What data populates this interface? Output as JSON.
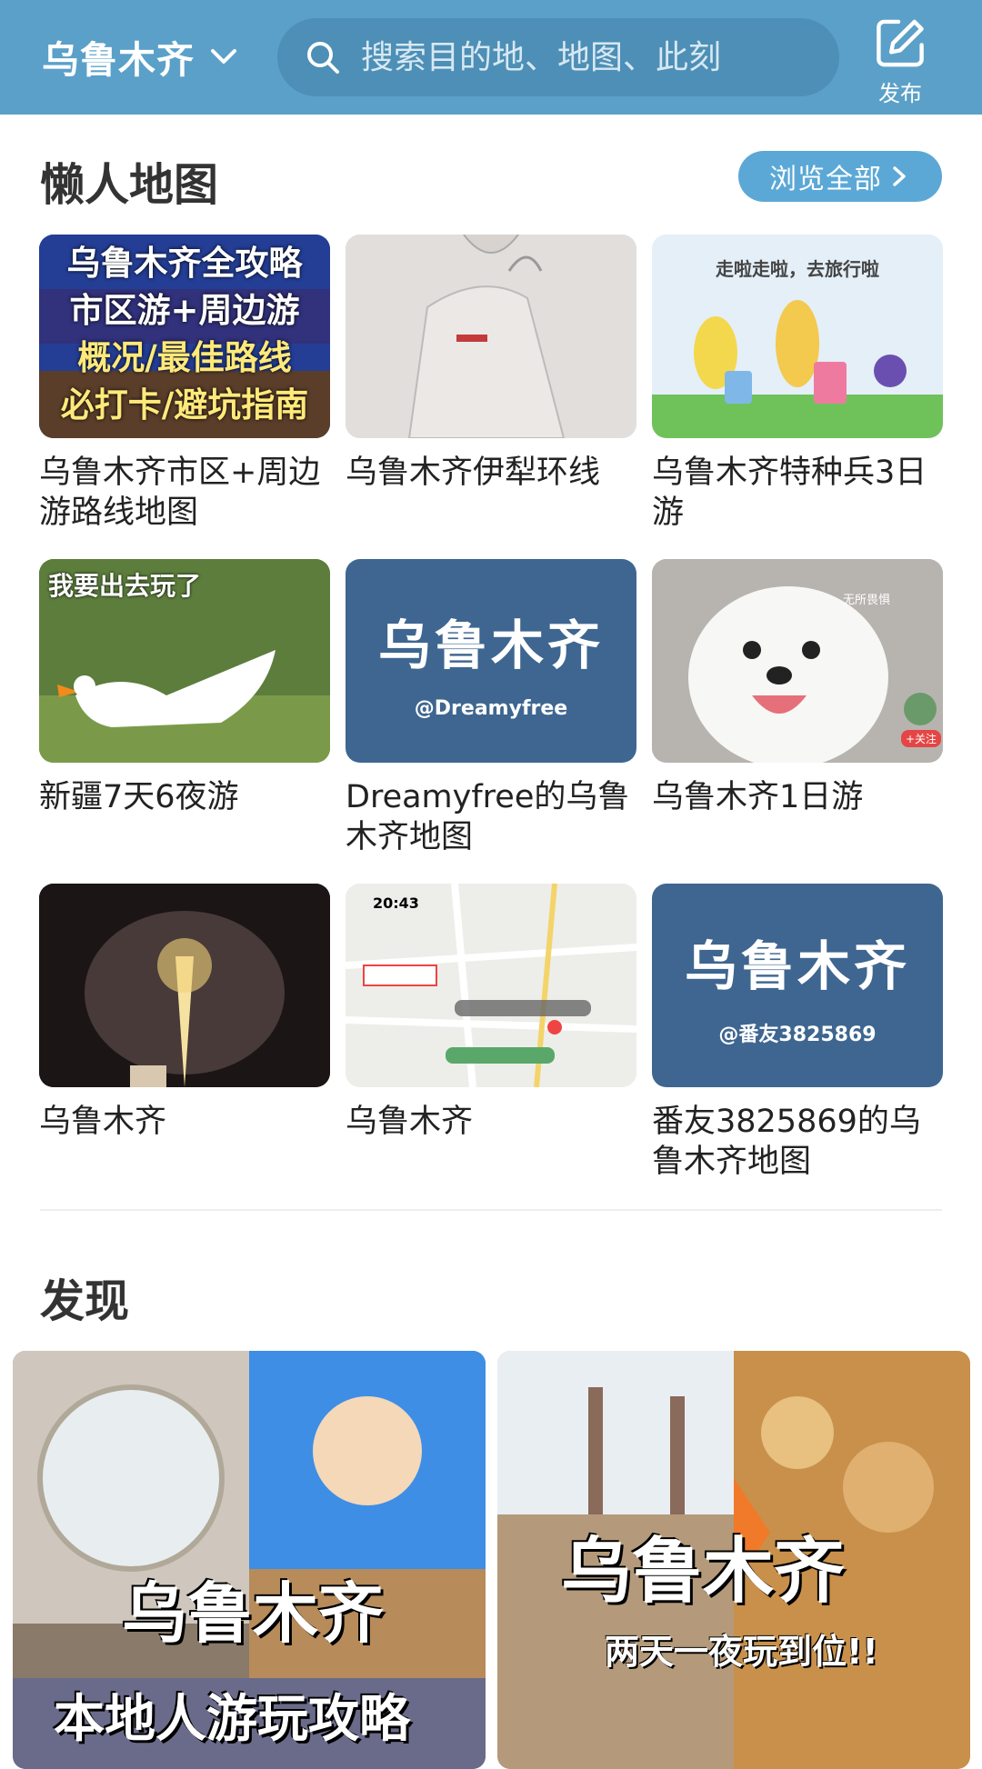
{
  "header": {
    "city": "乌鲁木齐",
    "search_placeholder": "搜索目的地、地图、此刻",
    "publish_label": "发布"
  },
  "lazy_maps": {
    "title": "懒人地图",
    "browse_all": "浏览全部",
    "cards": [
      {
        "title": "乌鲁木齐市区+周边游路线地图",
        "thumb_lines": [
          "乌鲁木齐全攻略",
          "市区游+周边游",
          "概况/最佳路线",
          "必打卡/避坑指南"
        ]
      },
      {
        "title": "乌鲁木齐伊犁环线"
      },
      {
        "title": "乌鲁木齐特种兵3日游",
        "thumb_text": "走啦走啦，去旅行啦"
      },
      {
        "title": "新疆7天6夜游",
        "thumb_text": "我要出去玩了"
      },
      {
        "title": "Dreamyfree的乌鲁木齐地图",
        "thumb_big": "乌鲁木齐",
        "thumb_sub": "@Dreamyfree"
      },
      {
        "title": "乌鲁木齐1日游",
        "thumb_text": "无所畏惧",
        "thumb_badge": "+关注"
      },
      {
        "title": "乌鲁木齐"
      },
      {
        "title": "乌鲁木齐",
        "thumb_time": "20:43"
      },
      {
        "title": "番友3825869的乌鲁木齐地图",
        "thumb_big": "乌鲁木齐",
        "thumb_sub": "@番友3825869"
      }
    ]
  },
  "discover": {
    "title": "发现",
    "posts": [
      {
        "line1": "乌鲁木齐",
        "line2": "本地人游玩攻略"
      },
      {
        "line1": "乌鲁木齐",
        "line2": "两天一夜玩到位!!"
      }
    ]
  },
  "colors": {
    "header_bg": "#5ba0c8",
    "accent": "#5ba8d6",
    "map_card_bg": "#3e6690"
  }
}
